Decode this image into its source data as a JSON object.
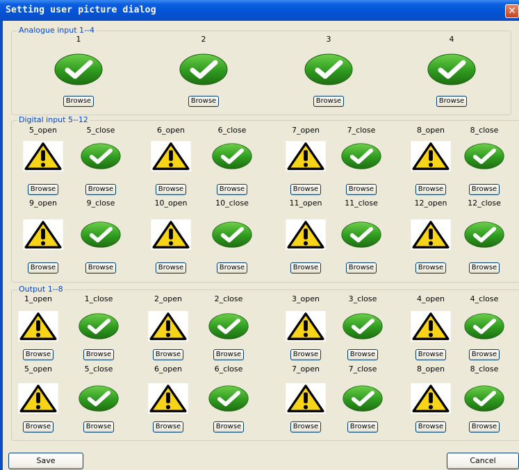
{
  "window": {
    "title": "Setting user picture dialog",
    "close_glyph": "✕"
  },
  "analogue": {
    "group_title": "Analogue input 1--4",
    "items": [
      {
        "label": "1",
        "icon": "check-icon",
        "button": "Browse"
      },
      {
        "label": "2",
        "icon": "check-icon",
        "button": "Browse"
      },
      {
        "label": "3",
        "icon": "check-icon",
        "button": "Browse"
      },
      {
        "label": "4",
        "icon": "check-icon",
        "button": "Browse"
      }
    ]
  },
  "digital": {
    "group_title": "Digital input 5--12",
    "rows": [
      [
        {
          "label": "5_open",
          "icon": "warning-icon",
          "button": "Browse"
        },
        {
          "label": "5_close",
          "icon": "check-icon",
          "button": "Browse"
        },
        {
          "label": "6_open",
          "icon": "warning-icon",
          "button": "Browse"
        },
        {
          "label": "6_close",
          "icon": "check-icon",
          "button": "Browse"
        },
        {
          "label": "7_open",
          "icon": "warning-icon",
          "button": "Browse"
        },
        {
          "label": "7_close",
          "icon": "check-icon",
          "button": "Browse"
        },
        {
          "label": "8_open",
          "icon": "warning-icon",
          "button": "Browse"
        },
        {
          "label": "8_close",
          "icon": "check-icon",
          "button": "Browse"
        }
      ],
      [
        {
          "label": "9_open",
          "icon": "warning-icon",
          "button": "Browse"
        },
        {
          "label": "9_close",
          "icon": "check-icon",
          "button": "Browse"
        },
        {
          "label": "10_open",
          "icon": "warning-icon",
          "button": "Browse"
        },
        {
          "label": "10_close",
          "icon": "check-icon",
          "button": "Browse"
        },
        {
          "label": "11_open",
          "icon": "warning-icon",
          "button": "Browse"
        },
        {
          "label": "11_close",
          "icon": "check-icon",
          "button": "Browse"
        },
        {
          "label": "12_open",
          "icon": "warning-icon",
          "button": "Browse"
        },
        {
          "label": "12_close",
          "icon": "check-icon",
          "button": "Browse"
        }
      ]
    ]
  },
  "output": {
    "group_title": "Output 1--8",
    "rows": [
      [
        {
          "label": "1_open",
          "icon": "warning-icon",
          "button": "Browse"
        },
        {
          "label": "1_close",
          "icon": "check-icon",
          "button": "Browse"
        },
        {
          "label": "2_open",
          "icon": "warning-icon",
          "button": "Browse"
        },
        {
          "label": "2_close",
          "icon": "check-icon",
          "button": "Browse"
        },
        {
          "label": "3_open",
          "icon": "warning-icon",
          "button": "Browse"
        },
        {
          "label": "3_close",
          "icon": "check-icon",
          "button": "Browse"
        },
        {
          "label": "4_open",
          "icon": "warning-icon",
          "button": "Browse"
        },
        {
          "label": "4_close",
          "icon": "check-icon",
          "button": "Browse"
        }
      ],
      [
        {
          "label": "5_open",
          "icon": "warning-icon",
          "button": "Browse"
        },
        {
          "label": "5_close",
          "icon": "check-icon",
          "button": "Browse"
        },
        {
          "label": "6_open",
          "icon": "warning-icon",
          "button": "Browse"
        },
        {
          "label": "6_close",
          "icon": "check-icon",
          "button": "Browse"
        },
        {
          "label": "7_open",
          "icon": "warning-icon",
          "button": "Browse"
        },
        {
          "label": "7_close",
          "icon": "check-icon",
          "button": "Browse"
        },
        {
          "label": "8_open",
          "icon": "warning-icon",
          "button": "Browse"
        },
        {
          "label": "8_close",
          "icon": "check-icon",
          "button": "Browse"
        }
      ]
    ]
  },
  "footer": {
    "save_label": "Save",
    "cancel_label": "Cancel"
  },
  "colors": {
    "titlebar": "#0453d4",
    "group_title": "#0046d5",
    "check_green": "#2e9a1e",
    "warning_yellow": "#f7d417"
  }
}
